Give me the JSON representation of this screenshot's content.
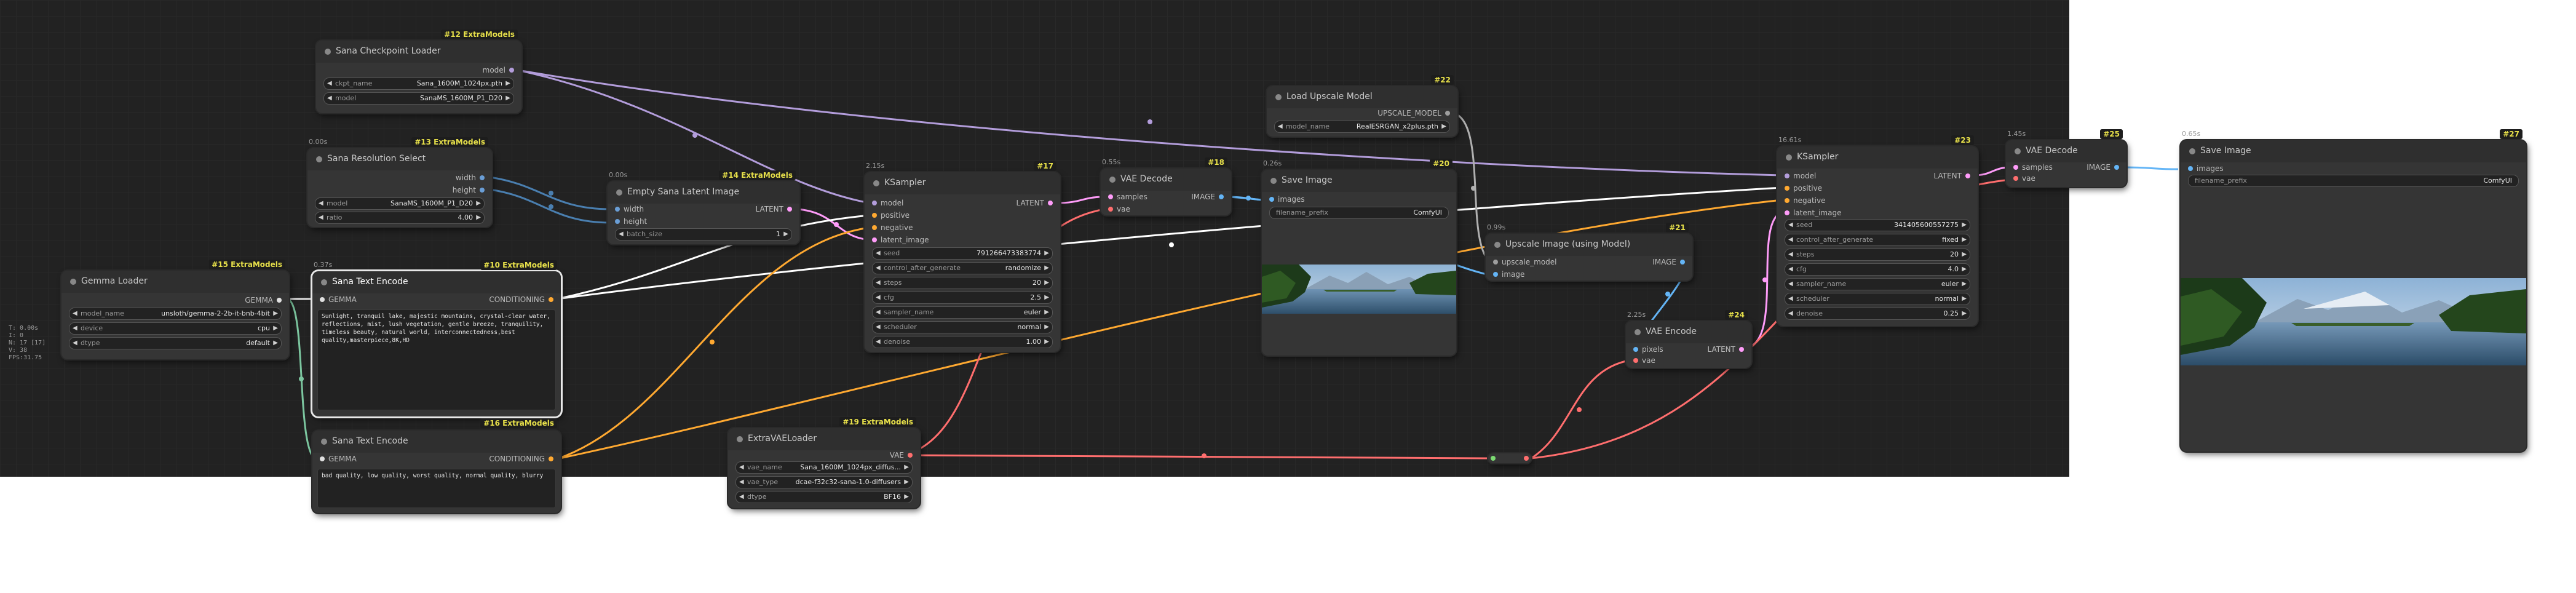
{
  "stats": [
    "T: 0.00s",
    "I: 0",
    "N: 17 [17]",
    "V: 38",
    "FPS:31.75"
  ],
  "nodes": {
    "n12": {
      "title": "Sana Checkpoint Loader",
      "badge": "#12 ExtraModels",
      "outputs": [
        "model"
      ],
      "widgets": [
        {
          "label": "ckpt_name",
          "value": "Sana_1600M_1024px.pth"
        },
        {
          "label": "model",
          "value": "SanaMS_1600M_P1_D20"
        }
      ]
    },
    "n13": {
      "title": "Sana Resolution Select",
      "badge": "#13 ExtraModels",
      "time": "0.00s",
      "outputs": [
        "width",
        "height"
      ],
      "widgets": [
        {
          "label": "model",
          "value": "SanaMS_1600M_P1_D20"
        },
        {
          "label": "ratio",
          "value": "4.00"
        }
      ]
    },
    "n15": {
      "title": "Gemma Loader",
      "badge": "#15 ExtraModels",
      "outputs": [
        "GEMMA"
      ],
      "widgets": [
        {
          "label": "model_name",
          "value": "unsloth/gemma-2-2b-it-bnb-4bit"
        },
        {
          "label": "device",
          "value": "cpu"
        },
        {
          "label": "dtype",
          "value": "default"
        }
      ]
    },
    "n10": {
      "title": "Sana Text Encode",
      "badge": "#10 ExtraModels",
      "time": "0.37s",
      "inputs": [
        "GEMMA"
      ],
      "outputs": [
        "CONDITIONING"
      ],
      "text": "Sunlight, tranquil lake, majestic mountains, crystal-clear water, reflections, mist, lush vegetation, gentle breeze, tranquility, timeless beauty, natural world, interconnectedness,best quality,masterpiece,8K,HD"
    },
    "n16": {
      "title": "Sana Text Encode",
      "badge": "#16 ExtraModels",
      "inputs": [
        "GEMMA"
      ],
      "outputs": [
        "CONDITIONING"
      ],
      "text": "bad quality, low quality, worst quality, normal quality, blurry"
    },
    "n14": {
      "title": "Empty Sana Latent Image",
      "badge": "#14 ExtraModels",
      "time": "0.00s",
      "inputs": [
        "width",
        "height"
      ],
      "outputs": [
        "LATENT"
      ],
      "widgets": [
        {
          "label": "batch_size",
          "value": "1"
        }
      ]
    },
    "n19": {
      "title": "ExtraVAELoader",
      "badge": "#19 ExtraModels",
      "outputs": [
        "VAE"
      ],
      "widgets": [
        {
          "label": "vae_name",
          "value": "Sana_1600M_1024px_diffus..."
        },
        {
          "label": "vae_type",
          "value": "dcae-f32c32-sana-1.0-diffusers"
        },
        {
          "label": "dtype",
          "value": "BF16"
        }
      ]
    },
    "n17": {
      "title": "KSampler",
      "badge": "#17",
      "time": "2.15s",
      "inputs": [
        "model",
        "positive",
        "negative",
        "latent_image"
      ],
      "outputs": [
        "LATENT"
      ],
      "widgets": [
        {
          "label": "seed",
          "value": "791266473383774"
        },
        {
          "label": "control_after_generate",
          "value": "randomize"
        },
        {
          "label": "steps",
          "value": "20"
        },
        {
          "label": "cfg",
          "value": "2.5"
        },
        {
          "label": "sampler_name",
          "value": "euler"
        },
        {
          "label": "scheduler",
          "value": "normal"
        },
        {
          "label": "denoise",
          "value": "1.00"
        }
      ]
    },
    "n18": {
      "title": "VAE Decode",
      "badge": "#18",
      "time": "0.55s",
      "inputs": [
        "samples",
        "vae"
      ],
      "outputs": [
        "IMAGE"
      ]
    },
    "n20": {
      "title": "Save Image",
      "badge": "#20",
      "time": "0.26s",
      "inputs": [
        "images"
      ],
      "widgets": [
        {
          "label": "filename_prefix",
          "value": "ComfyUI"
        }
      ]
    },
    "n22": {
      "title": "Load Upscale Model",
      "badge": "#22",
      "outputs": [
        "UPSCALE_MODEL"
      ],
      "widgets": [
        {
          "label": "model_name",
          "value": "RealESRGAN_x2plus.pth"
        }
      ]
    },
    "n21": {
      "title": "Upscale Image (using Model)",
      "badge": "#21",
      "time": "0.99s",
      "inputs": [
        "upscale_model",
        "image"
      ],
      "outputs": [
        "IMAGE"
      ]
    },
    "n24": {
      "title": "VAE Encode",
      "badge": "#24",
      "time": "2.25s",
      "inputs": [
        "pixels",
        "vae"
      ],
      "outputs": [
        "LATENT"
      ]
    },
    "n23": {
      "title": "KSampler",
      "badge": "#23",
      "time": "16.61s",
      "inputs": [
        "model",
        "positive",
        "negative",
        "latent_image"
      ],
      "outputs": [
        "LATENT"
      ],
      "widgets": [
        {
          "label": "seed",
          "value": "341405600557275"
        },
        {
          "label": "control_after_generate",
          "value": "fixed"
        },
        {
          "label": "steps",
          "value": "20"
        },
        {
          "label": "cfg",
          "value": "4.0"
        },
        {
          "label": "sampler_name",
          "value": "euler"
        },
        {
          "label": "scheduler",
          "value": "normal"
        },
        {
          "label": "denoise",
          "value": "0.25"
        }
      ]
    },
    "n25": {
      "title": "VAE Decode",
      "badge": "#25",
      "time": "1.45s",
      "inputs": [
        "samples",
        "vae"
      ],
      "outputs": [
        "IMAGE"
      ]
    },
    "n27": {
      "title": "Save Image",
      "badge": "#27",
      "time": "0.65s",
      "inputs": [
        "images"
      ],
      "widgets": [
        {
          "label": "filename_prefix",
          "value": "ComfyUI"
        }
      ]
    }
  },
  "colors": {
    "model": "#b39ddb",
    "conditioning": "#ffa931",
    "latent": "#ff9cf9",
    "vae": "#ff6e6e",
    "image": "#64b5f6",
    "int": "#6a9ed6",
    "gemma": "#e0e0e0",
    "upscale": "#9e9e9e",
    "text_link": "#ffffff",
    "badge": "#e7e04a"
  }
}
